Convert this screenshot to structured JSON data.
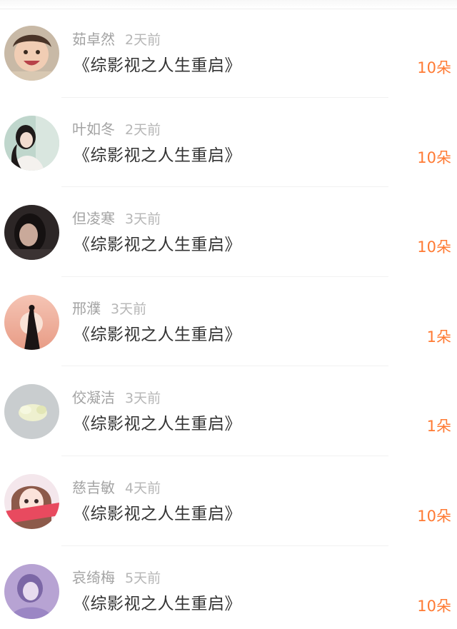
{
  "entries": [
    {
      "name": "茹卓然",
      "time": "2天前",
      "book": "《综影视之人生重启》",
      "amount": "10朵",
      "avatar_icon": "girl-smiling-avatar-icon"
    },
    {
      "name": "叶如冬",
      "time": "2天前",
      "book": "《综影视之人生重启》",
      "amount": "10朵",
      "avatar_icon": "woman-portrait-avatar-icon"
    },
    {
      "name": "但凌寒",
      "time": "3天前",
      "book": "《综影视之人生重启》",
      "amount": "10朵",
      "avatar_icon": "dark-portrait-avatar-icon"
    },
    {
      "name": "邢濮",
      "time": "3天前",
      "book": "《综影视之人生重启》",
      "amount": "1朵",
      "avatar_icon": "sunset-silhouette-avatar-icon"
    },
    {
      "name": "佼凝洁",
      "time": "3天前",
      "book": "《综影视之人生重启》",
      "amount": "1朵",
      "avatar_icon": "jade-stone-avatar-icon"
    },
    {
      "name": "慈吉敏",
      "time": "4天前",
      "book": "《综影视之人生重启》",
      "amount": "10朵",
      "avatar_icon": "cartoon-girl-avatar-icon"
    },
    {
      "name": "哀绮梅",
      "time": "5天前",
      "book": "《综影视之人生重启》",
      "amount": "10朵",
      "avatar_icon": "purple-portrait-avatar-icon"
    }
  ],
  "colors": {
    "amount": "#ff7a33",
    "name": "#a3a3a3",
    "time": "#b6b6b6",
    "book": "#333333"
  }
}
